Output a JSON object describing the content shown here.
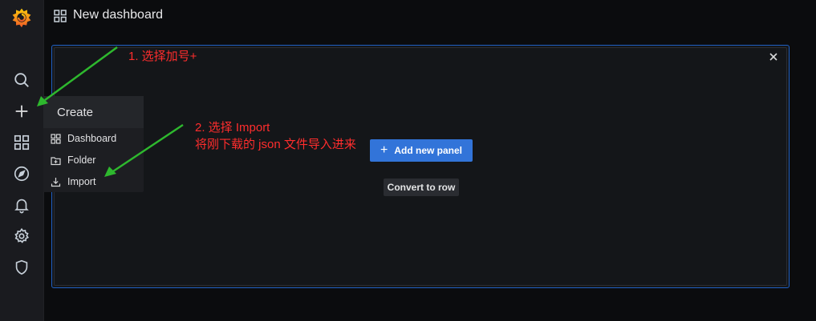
{
  "header": {
    "title": "New dashboard"
  },
  "sidebar": {
    "items": [
      {
        "name": "grafana-logo-icon"
      },
      {
        "name": "search-icon"
      },
      {
        "name": "plus-icon"
      },
      {
        "name": "dashboards-icon"
      },
      {
        "name": "explore-compass-icon"
      },
      {
        "name": "alerting-bell-icon"
      },
      {
        "name": "configuration-gear-icon"
      },
      {
        "name": "server-admin-shield-icon"
      }
    ]
  },
  "create_menu": {
    "title": "Create",
    "items": [
      {
        "label": "Dashboard",
        "icon": "dashboard-grid-icon"
      },
      {
        "label": "Folder",
        "icon": "folder-plus-icon"
      },
      {
        "label": "Import",
        "icon": "import-icon"
      }
    ]
  },
  "panel": {
    "add_button": "Add new panel",
    "convert_button": "Convert to row"
  },
  "annotations": {
    "step1": "1. 选择加号+",
    "step2_line1": "2. 选择 Import",
    "step2_line2": "将刚下载的 json 文件导入进来"
  },
  "colors": {
    "accent_blue": "#3274d9",
    "panel_border": "#1f60c4",
    "annotation_red": "#ff2d2d",
    "arrow_green": "#2eb82e",
    "logo_orange": "#f05a28"
  }
}
